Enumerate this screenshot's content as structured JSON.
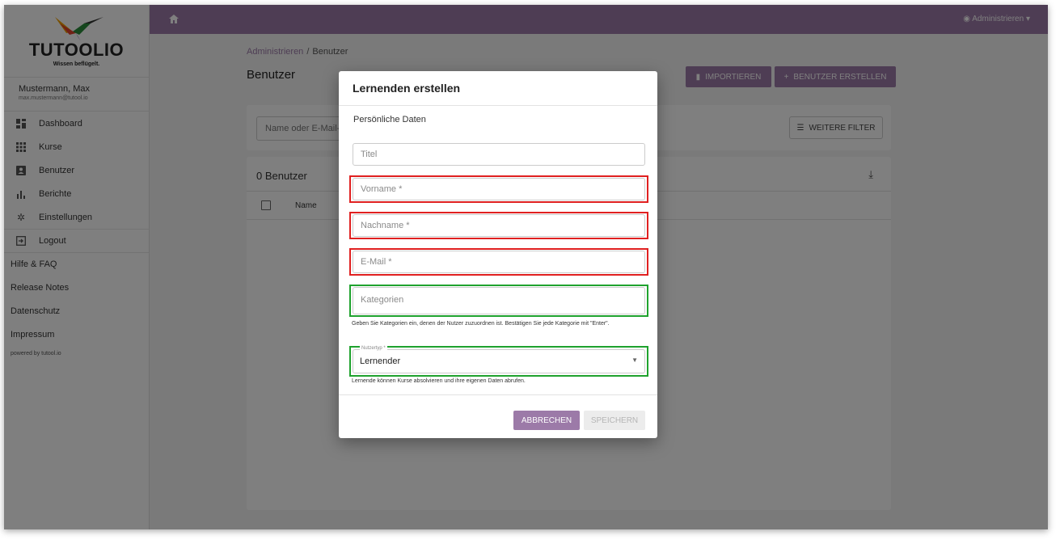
{
  "app": {
    "logo_text": "TUTOOLIO",
    "logo_tagline": "Wissen beflügelt."
  },
  "user": {
    "name": "Mustermann, Max",
    "email": "max.mustermann@tutool.io"
  },
  "sidebar": {
    "items": [
      {
        "label": "Dashboard",
        "icon": "dashboard-icon"
      },
      {
        "label": "Kurse",
        "icon": "grid-icon"
      },
      {
        "label": "Benutzer",
        "icon": "user-icon"
      },
      {
        "label": "Berichte",
        "icon": "bar-chart-icon"
      },
      {
        "label": "Einstellungen",
        "icon": "gear-icon"
      },
      {
        "label": "Logout",
        "icon": "logout-icon"
      }
    ],
    "links": [
      "Hilfe & FAQ",
      "Release Notes",
      "Datenschutz",
      "Impressum"
    ],
    "powered": "powered by tutool.io"
  },
  "topbar": {
    "admin_label": "Administrieren"
  },
  "page": {
    "breadcrumb_root": "Administrieren",
    "breadcrumb_current": "Benutzer",
    "title": "Benutzer",
    "import_label": "IMPORTIEREN",
    "create_label": "BENUTZER ERSTELLEN",
    "search_placeholder": "Name oder E-Mail-A",
    "more_filter_label": "WEITERE FILTER",
    "count_label": "0 Benutzer",
    "col_name": "Name"
  },
  "modal": {
    "title": "Lernenden erstellen",
    "section_label": "Persönliche Daten",
    "fields": {
      "title_placeholder": "Titel",
      "firstname_placeholder": "Vorname *",
      "lastname_placeholder": "Nachname *",
      "email_placeholder": "E-Mail *",
      "categories_placeholder": "Kategorien"
    },
    "categories_help": "Geben Sie Kategorien ein, denen der Nutzer zuzuordnen ist. Bestätigen Sie jede Kategorie mit \"Enter\".",
    "usertype_legend": "Nutzertyp *",
    "usertype_value": "Lernender",
    "usertype_help": "Lernende können Kurse absolvieren und ihre eigenen Daten abrufen.",
    "cancel_label": "ABBRECHEN",
    "save_label": "SPEICHERN"
  },
  "colors": {
    "accent": "#9c7aa8",
    "required_highlight": "#e02020",
    "optional_highlight": "#1fa22e"
  }
}
